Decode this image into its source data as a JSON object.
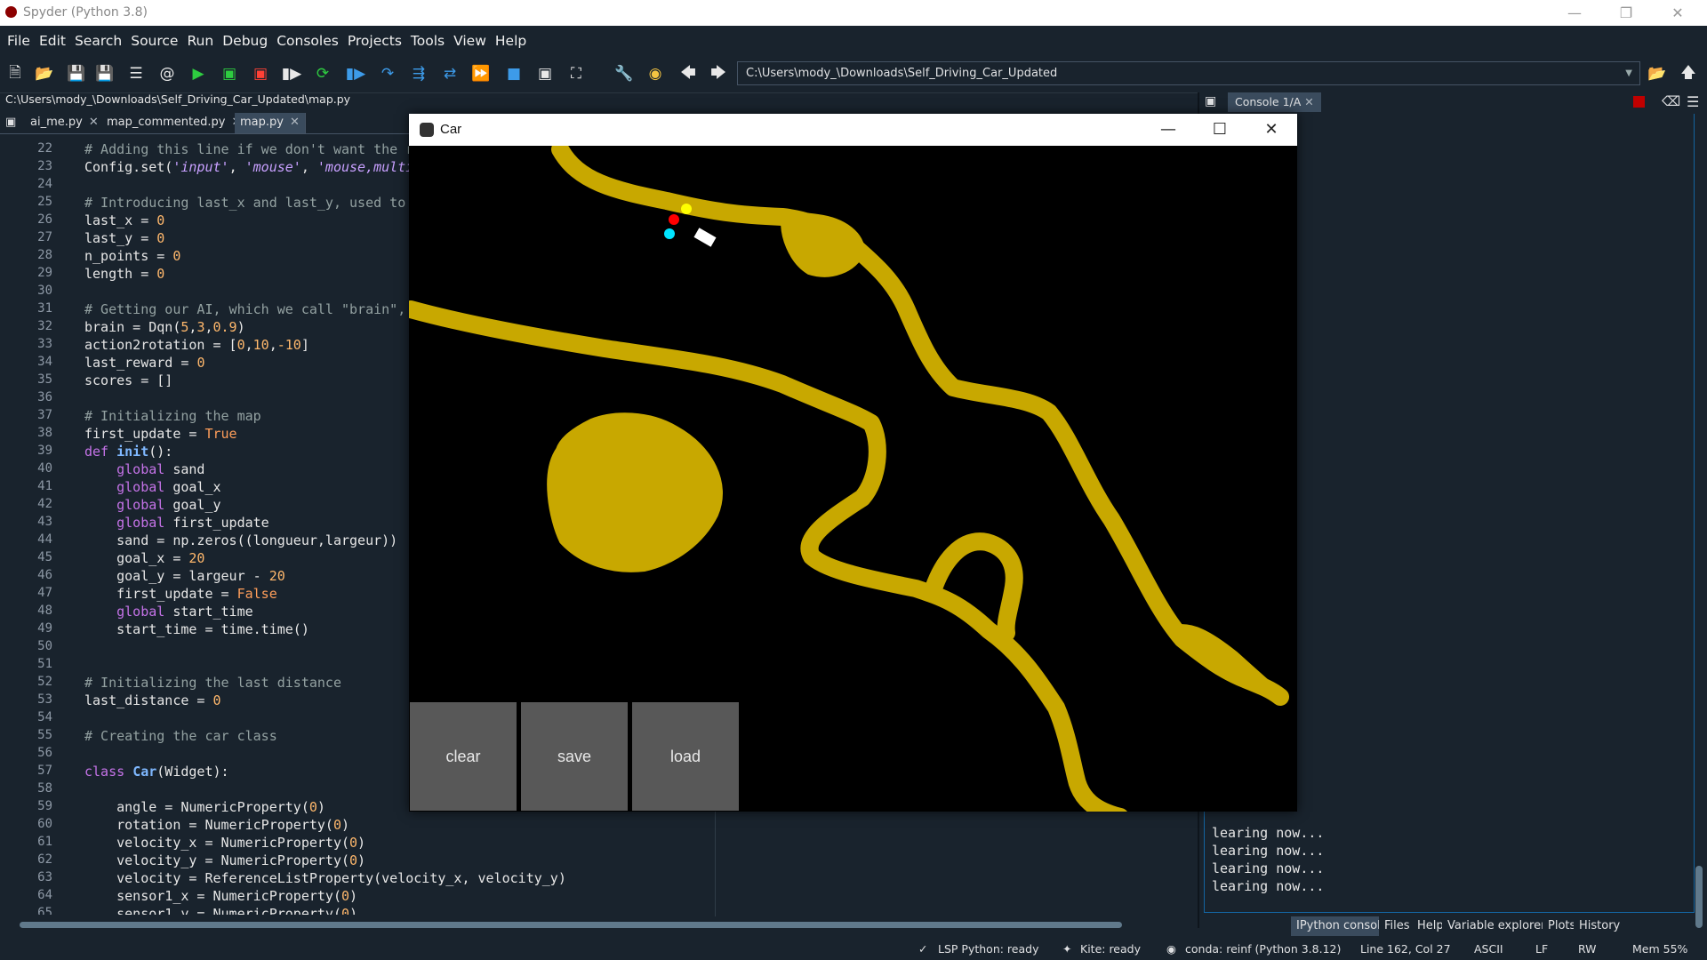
{
  "window": {
    "title": "Spyder (Python 3.8)"
  },
  "menu": [
    "File",
    "Edit",
    "Search",
    "Source",
    "Run",
    "Debug",
    "Consoles",
    "Projects",
    "Tools",
    "View",
    "Help"
  ],
  "toolbar": {
    "path": "C:\\Users\\mody_\\Downloads\\Self_Driving_Car_Updated"
  },
  "editor": {
    "filepath": "C:\\Users\\mody_\\Downloads\\Self_Driving_Car_Updated\\map.py",
    "tabs": [
      {
        "label": "ai_me.py"
      },
      {
        "label": "map_commented.py"
      },
      {
        "label": "map.py"
      }
    ],
    "line_numbers": [
      "22",
      "23",
      "24",
      "25",
      "26",
      "27",
      "28",
      "29",
      "30",
      "31",
      "32",
      "33",
      "34",
      "35",
      "36",
      "37",
      "38",
      "39",
      "40",
      "41",
      "42",
      "43",
      "44",
      "45",
      "46",
      "47",
      "48",
      "49",
      "50",
      "51",
      "52",
      "53",
      "54",
      "55",
      "56",
      "57",
      "58",
      "59",
      "60",
      "61",
      "62",
      "63",
      "64",
      "65"
    ]
  },
  "console": {
    "tab_label": "Console 1/A",
    "ellipsis": "...",
    "learning": "learing now..."
  },
  "bottom_tabs": [
    "IPython console",
    "Files",
    "Help",
    "Variable explorer",
    "Plots",
    "History"
  ],
  "status": {
    "lsp": "LSP Python: ready",
    "kite": "Kite: ready",
    "conda": "conda: reinf (Python 3.8.12)",
    "position": "Line 162, Col 27",
    "encoding": "ASCII",
    "eol": "LF",
    "mode": "RW",
    "mem": "Mem 55%"
  },
  "car_window": {
    "title": "Car",
    "buttons": {
      "clear": "clear",
      "save": "save",
      "load": "load"
    },
    "colors": {
      "sand": "#c8a800",
      "car": "#ffffff",
      "sensor1": "#ff0000",
      "sensor2": "#ffff00",
      "sensor3": "#00e5ff"
    }
  }
}
